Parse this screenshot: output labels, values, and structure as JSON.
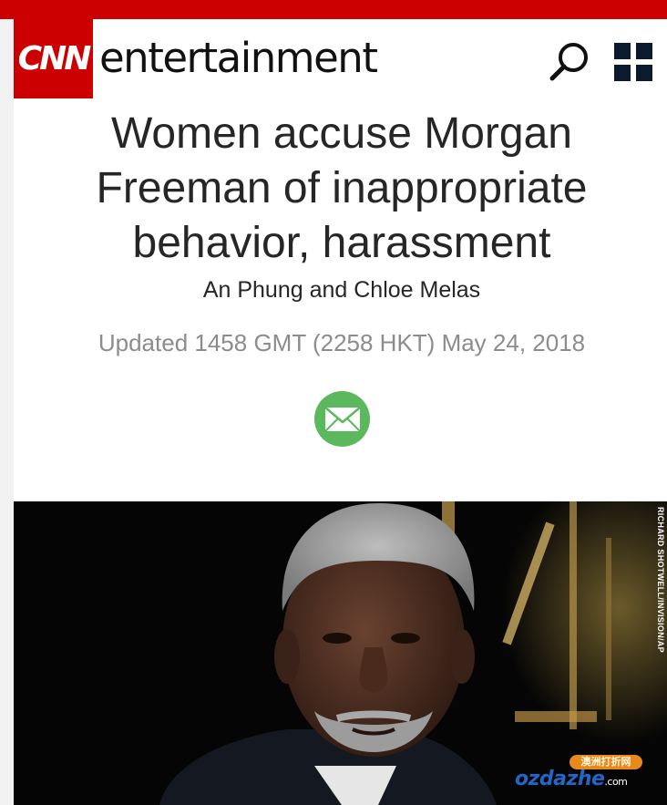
{
  "header": {
    "logo_text": "CNN",
    "section_name": "entertainment",
    "search_icon": "search-icon",
    "menu_icon": "grid-menu-icon"
  },
  "article": {
    "headline": "Women accuse Morgan Freeman of inappropriate behavior, harassment",
    "byline": "An Phung and Chloe Melas",
    "timestamp": "Updated 1458 GMT (2258 HKT) May 24, 2018",
    "share_icon": "email-icon"
  },
  "hero_image": {
    "description_icon": "photo-portrait",
    "credit": "RICHARD SHOTWELL/INVISION/AP"
  },
  "watermark": {
    "badge": "澳洲打折网",
    "text": "ozdazhe",
    "tld": ".com"
  },
  "colors": {
    "brand_red": "#cc0000",
    "share_green": "#5cb85c",
    "headline_text": "#262626",
    "timestamp_text": "#8c8c8c"
  }
}
